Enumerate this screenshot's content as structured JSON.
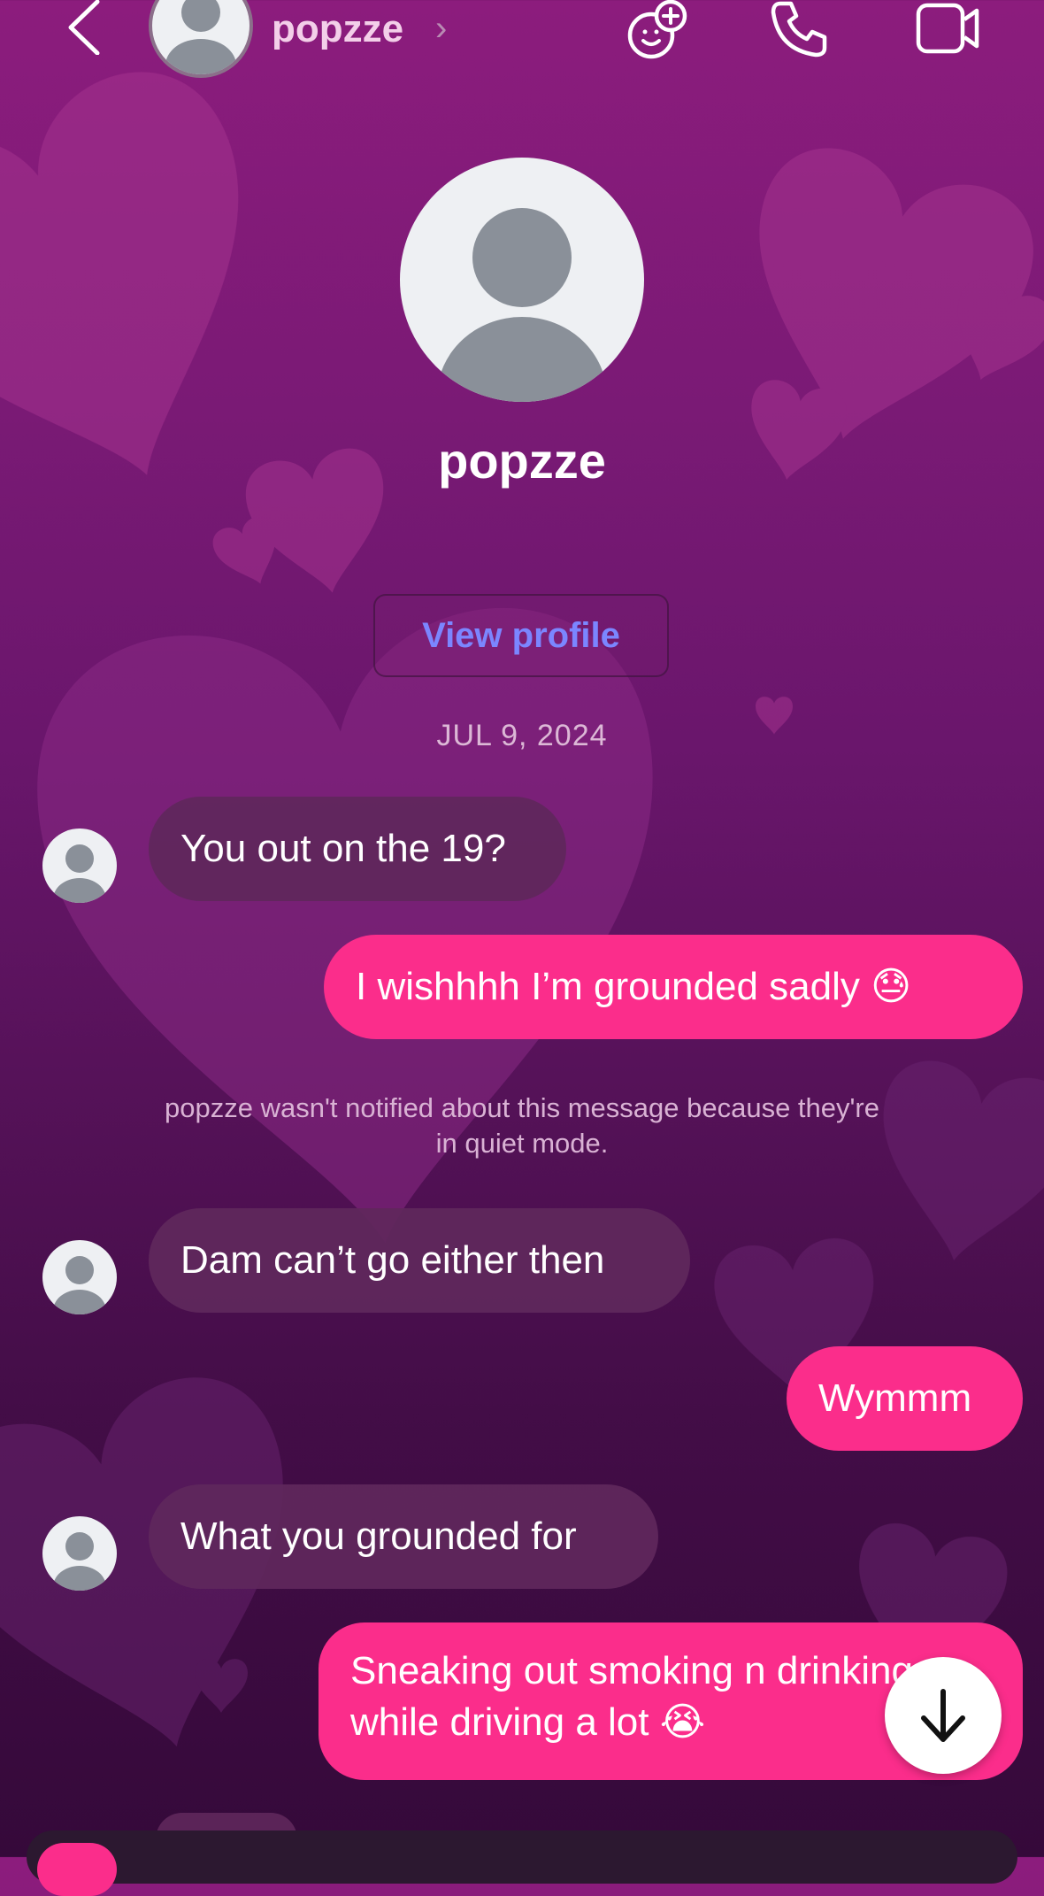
{
  "header": {
    "contact_name": "popzze",
    "chevron": "›",
    "icons": [
      "back-icon",
      "effects-icon",
      "phone-icon",
      "video-icon"
    ]
  },
  "profile": {
    "name": "popzze",
    "view_profile_label": "View profile"
  },
  "date_separator": "JUL 9, 2024",
  "messages": [
    {
      "direction": "incoming",
      "text": "You out on the 19?"
    },
    {
      "direction": "outgoing",
      "text": "I wishhhh I’m grounded sadly 😓"
    },
    {
      "direction": "incoming",
      "text": "Dam can’t go either then"
    },
    {
      "direction": "outgoing",
      "text": "Wymmm"
    },
    {
      "direction": "incoming",
      "text": "What you grounded for"
    },
    {
      "direction": "outgoing",
      "text": "Sneaking out smoking n drinking while driving a lot 😭"
    }
  ],
  "quiet_mode_notice": "popzze wasn't notified about this message because they're in quiet mode.",
  "colors": {
    "outgoing_bubble": "#fb2d8b",
    "incoming_bubble": "#5f285c",
    "link": "#7b86ff",
    "background_top": "#8c1c7d",
    "background_bottom": "#35093a"
  }
}
